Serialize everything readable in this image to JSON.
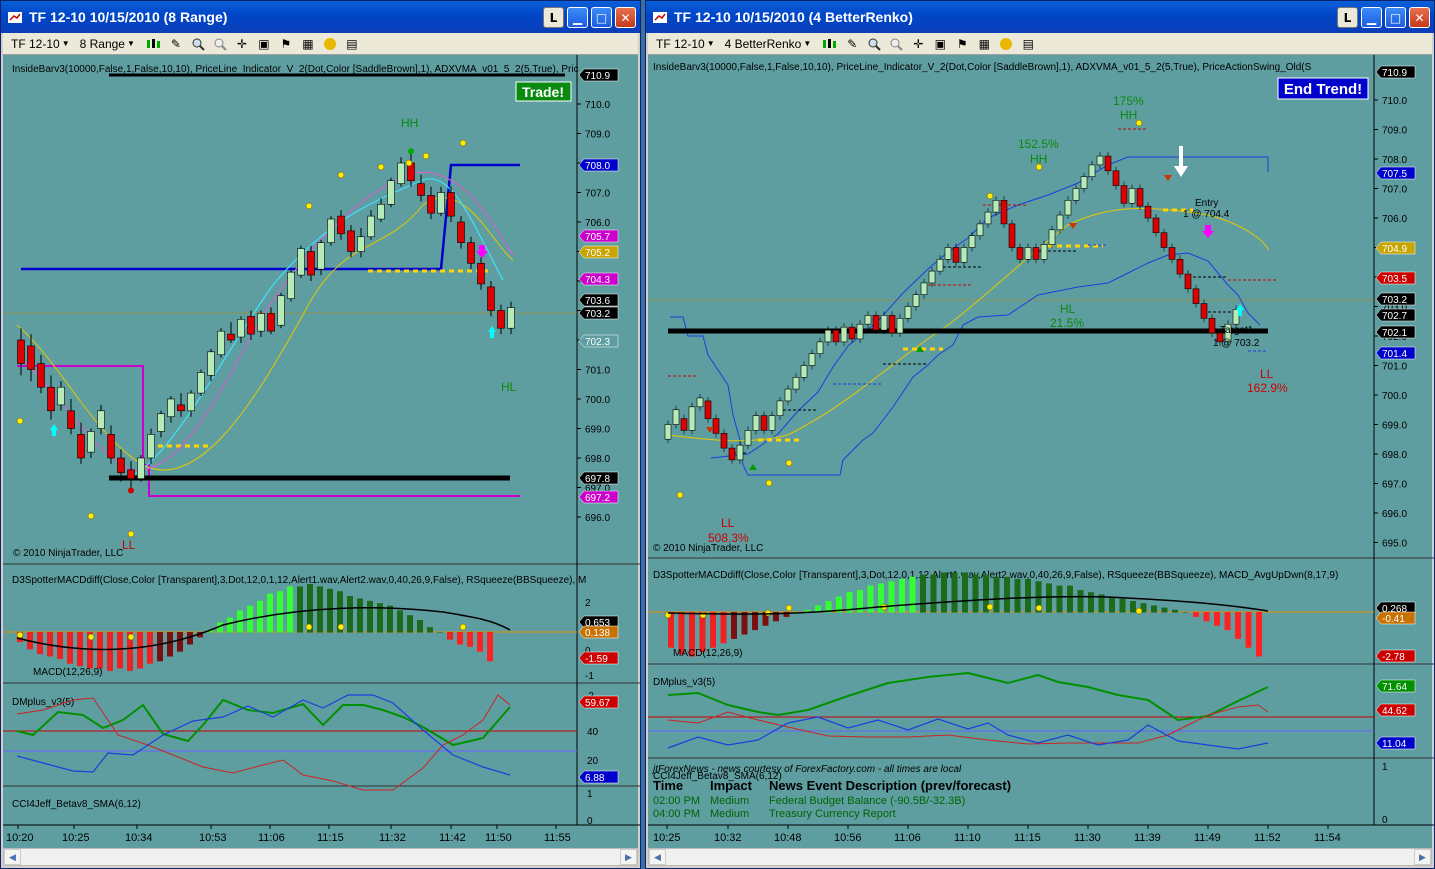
{
  "left": {
    "title": "TF 12-10  10/15/2010 (8 Range)",
    "toolbar": {
      "instrument": "TF 12-10",
      "period": "8 Range"
    },
    "indicators_text": "InsideBarv3(10000,False,1,False,10,10), PriceLine_Indicator_V_2(Dot,Color [SaddleBrown],1),   ADXVMA_v01_5_2(5,True), Pric",
    "badge": "Trade!",
    "copyright": "© 2010 NinjaTrader, LLC",
    "swing_labels": {
      "hh": "HH",
      "hl": "HL",
      "ll": "LL"
    },
    "price_ticks": [
      "710.0",
      "709.0",
      "708.0",
      "707.0",
      "706.0",
      "705.0",
      "704.0",
      "703.0",
      "702.0",
      "701.0",
      "700.0",
      "699.0",
      "698.0",
      "697.0",
      "696.0"
    ],
    "price_flags": [
      {
        "text": "710.9",
        "color": "#000000"
      },
      {
        "text": "708.0",
        "color": "#0000cc"
      },
      {
        "text": "705.7",
        "color": "#cc00cc"
      },
      {
        "text": "705.2",
        "color": "#c8a400"
      },
      {
        "text": "704.3",
        "color": "#cc00cc"
      },
      {
        "text": "703.6",
        "color": "#000000"
      },
      {
        "text": "703.2",
        "color": "#000000"
      },
      {
        "text": "702.3",
        "color": "#5f9ea0"
      },
      {
        "text": "697.8",
        "color": "#000000"
      },
      {
        "text": "697.2",
        "color": "#cc00cc"
      }
    ],
    "macd": {
      "label": "D3SpotterMACDdiff(Close,Color [Transparent],3,Dot,12,0,1,12,Alert1.wav,Alert2.wav,0,40,26,9,False), RSqueeze(BBSqueeze), M",
      "sub": "MACD(12,26,9)",
      "ticks": [
        "2",
        "1",
        "0",
        "-1",
        "-2"
      ],
      "flags": [
        {
          "text": "0.653",
          "color": "#000000"
        },
        {
          "text": "0.138",
          "color": "#c87000"
        },
        {
          "text": "-1.59",
          "color": "#cc0000"
        }
      ]
    },
    "dm": {
      "label": "DMplus_v3(5)",
      "ticks": [
        "40",
        "20"
      ],
      "flags": [
        {
          "text": "59.67",
          "color": "#cc0000"
        },
        {
          "text": "6.88",
          "color": "#0000cc"
        }
      ]
    },
    "cci": {
      "label": "CCI4Jeff_Betav8_SMA(6,12)",
      "ticks": [
        "1",
        "0"
      ]
    },
    "time_ticks": [
      "10:20",
      "10:25",
      "10:34",
      "10:53",
      "11:06",
      "11:15",
      "11:32",
      "11:42",
      "11:50",
      "11:55"
    ]
  },
  "right": {
    "title": "TF 12-10  10/15/2010 (4 BetterRenko)",
    "toolbar": {
      "instrument": "TF 12-10",
      "period": "4 BetterRenko"
    },
    "indicators_text": "InsideBarv3(10000,False,1,False,10,10), PriceLine_Indicator_V_2(Dot,Color [SaddleBrown],1),   ADXVMA_v01_5_2(5,True), PriceActionSwing_Old(S",
    "badge": "End Trend!",
    "copyright": "© 2010 NinjaTrader, LLC",
    "annotations": {
      "hh1_pct": "175%",
      "hh1": "HH",
      "hh2_pct": "152.5%",
      "hh2": "HH",
      "hl": "HL",
      "hl_pct": "21.5%",
      "ll1": "LL",
      "ll1_pct": "508.3%",
      "ll2": "LL",
      "ll2_pct": "162.9%",
      "entry": "Entry",
      "entry_at": "1 @ 704.4",
      "target": "Target1",
      "target_at": "1 @ 703.2"
    },
    "price_ticks": [
      "710.0",
      "709.0",
      "708.0",
      "707.0",
      "706.0",
      "705.0",
      "704.0",
      "703.0",
      "702.0",
      "701.0",
      "700.0",
      "699.0",
      "698.0",
      "697.0",
      "696.0",
      "695.0"
    ],
    "price_flags": [
      {
        "text": "710.9",
        "color": "#000000"
      },
      {
        "text": "707.5",
        "color": "#0000cc"
      },
      {
        "text": "704.9",
        "color": "#c8a400"
      },
      {
        "text": "703.5",
        "color": "#cc0000"
      },
      {
        "text": "703.2",
        "color": "#000000"
      },
      {
        "text": "702.7",
        "color": "#000000"
      },
      {
        "text": "702.1",
        "color": "#000000"
      },
      {
        "text": "701.4",
        "color": "#0000cc"
      }
    ],
    "macd": {
      "label": "D3SpotterMACDdiff(Close,Color [Transparent],3,Dot,12,0,1,12,Alert1.wav,Alert2.wav,0,40,26,9,False), RSqueeze(BBSqueeze), MACD_AvgUpDwn(8,17,9)",
      "sub": "MACD(12,26,9)",
      "flags": [
        {
          "text": "0.268",
          "color": "#000000"
        },
        {
          "text": "-0.41",
          "color": "#c87000"
        },
        {
          "text": "-2.78",
          "color": "#cc0000"
        }
      ]
    },
    "dm": {
      "label": "DMplus_v3(5)",
      "flags": [
        {
          "text": "71.64",
          "color": "#009000"
        },
        {
          "text": "44.62",
          "color": "#cc0000"
        },
        {
          "text": "11.04",
          "color": "#0000cc"
        }
      ]
    },
    "cci": {
      "label": "CCI4Jeff_Betav8_SMA(6,12)",
      "ticks": [
        "1",
        "0"
      ]
    },
    "news": {
      "credit": "jtForexNews - news courtesy of ForexFactory.com - all times are local",
      "headers": [
        "Time",
        "Impact",
        "News Event Description (prev/forecast)"
      ],
      "rows": [
        [
          "02:00 PM",
          "Medium",
          "Federal Budget Balance (-90.5B/-32.3B)"
        ],
        [
          "04:00 PM",
          "Medium",
          "Treasury Currency Report"
        ]
      ]
    },
    "time_ticks": [
      "10:25",
      "10:32",
      "10:48",
      "10:56",
      "11:06",
      "11:10",
      "11:15",
      "11:30",
      "11:39",
      "11:49",
      "11:52",
      "11:54"
    ]
  }
}
